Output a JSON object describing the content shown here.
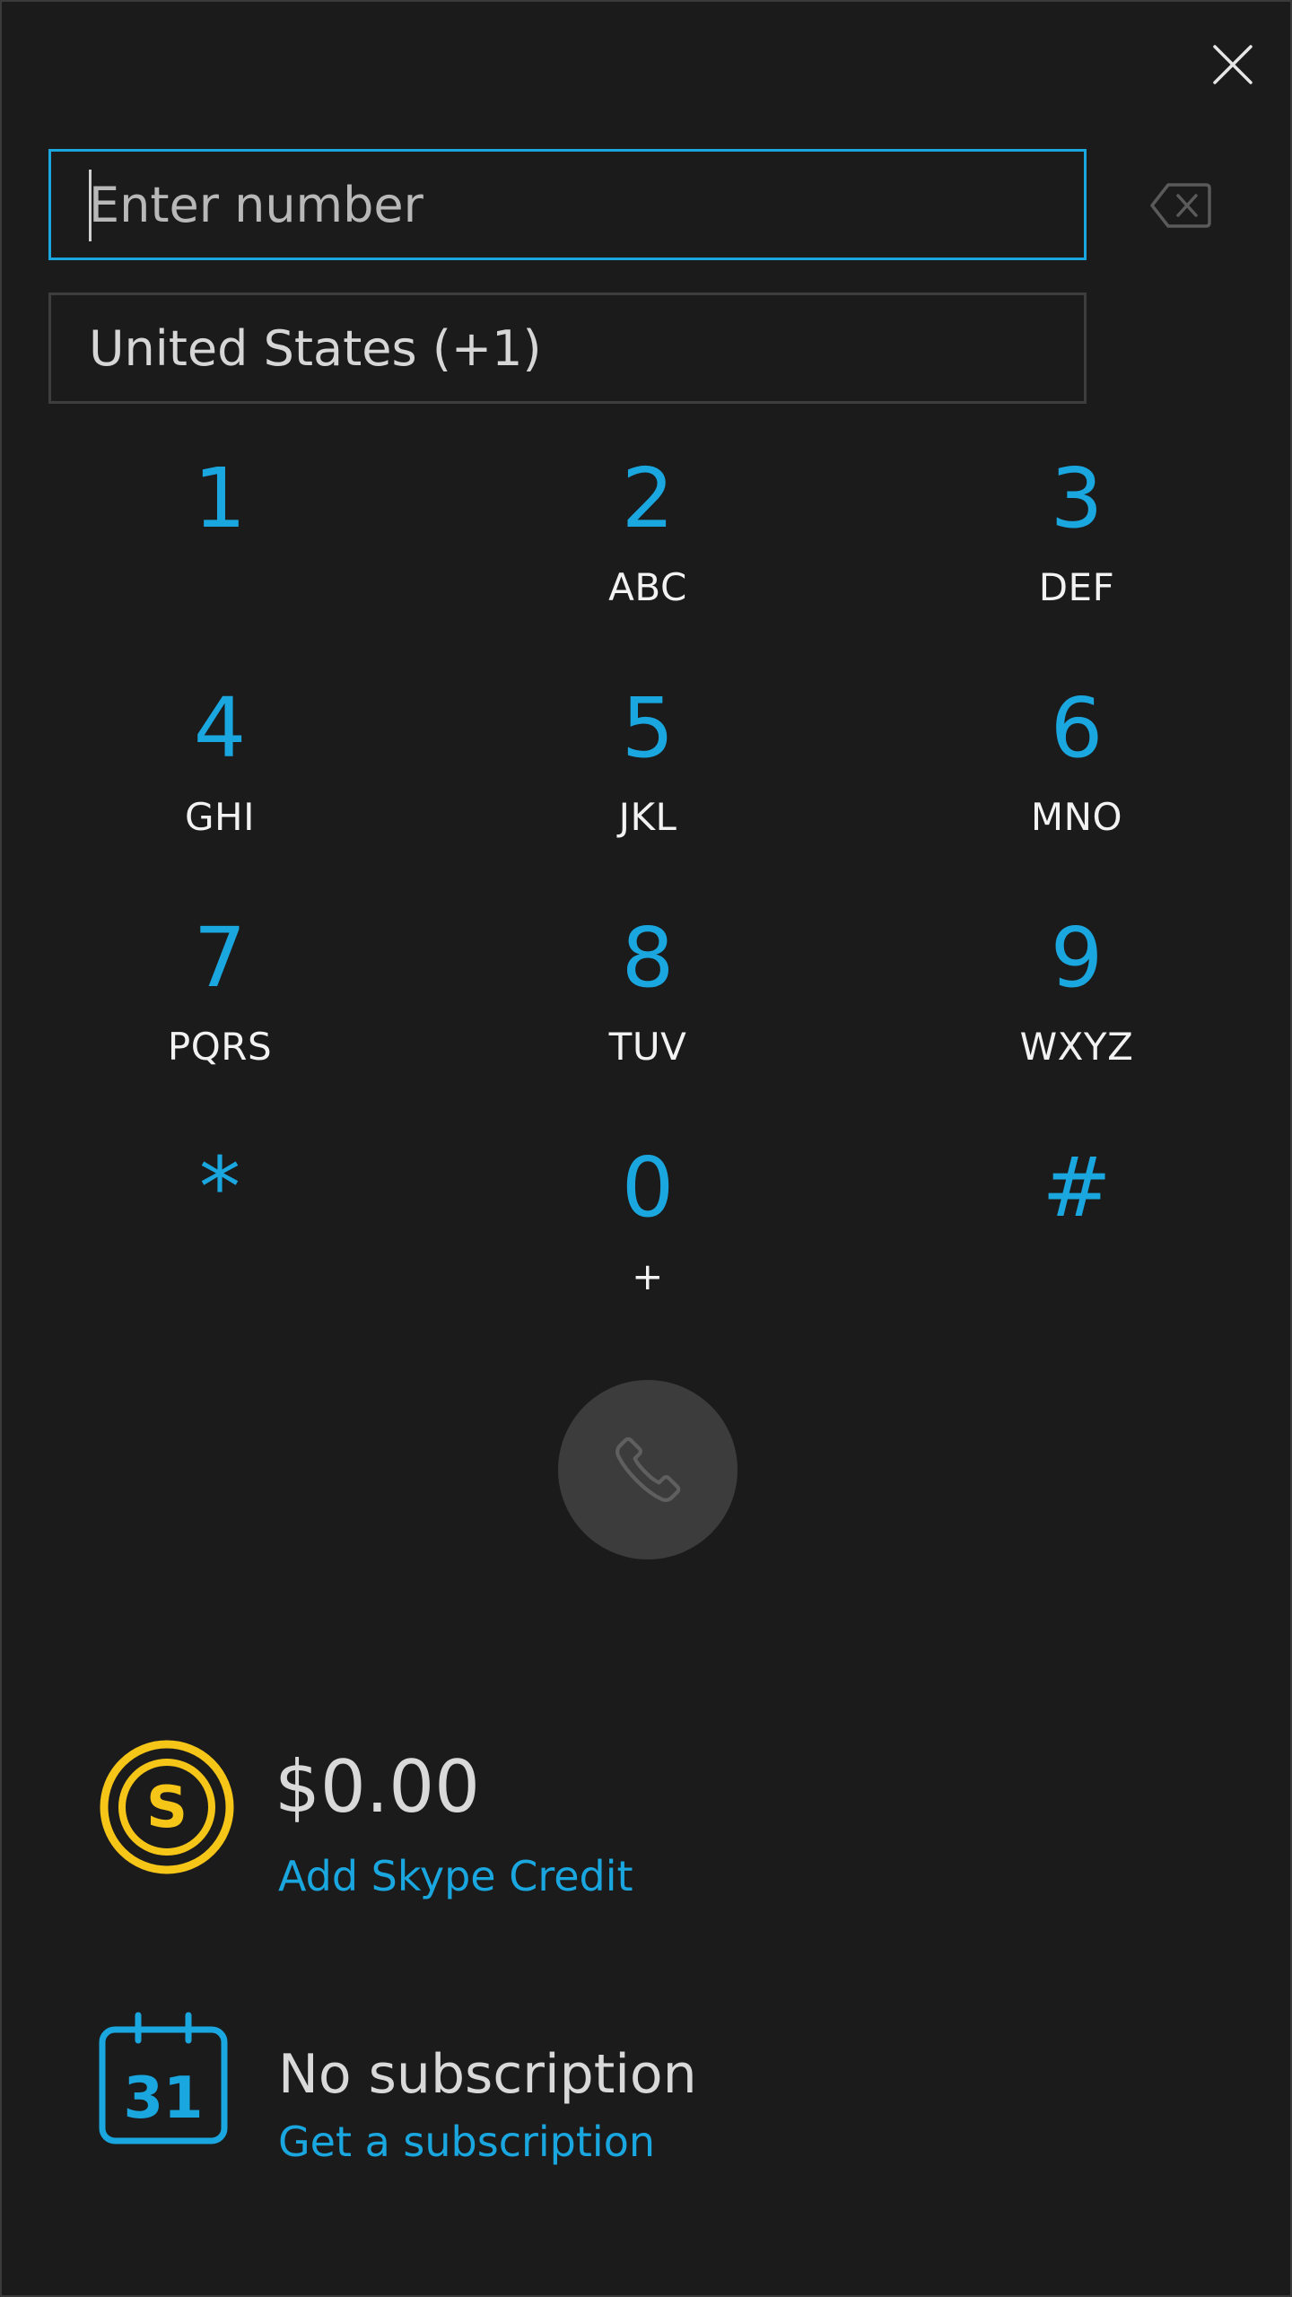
{
  "dialer": {
    "number_placeholder": "Enter number",
    "number_value": "",
    "country": "United States (+1)"
  },
  "keypad": [
    {
      "digit": "1",
      "letters": ""
    },
    {
      "digit": "2",
      "letters": "ABC"
    },
    {
      "digit": "3",
      "letters": "DEF"
    },
    {
      "digit": "4",
      "letters": "GHI"
    },
    {
      "digit": "5",
      "letters": "JKL"
    },
    {
      "digit": "6",
      "letters": "MNO"
    },
    {
      "digit": "7",
      "letters": "PQRS"
    },
    {
      "digit": "8",
      "letters": "TUV"
    },
    {
      "digit": "9",
      "letters": "WXYZ"
    },
    {
      "digit": "*",
      "letters": ""
    },
    {
      "digit": "0",
      "letters": "+"
    },
    {
      "digit": "#",
      "letters": ""
    }
  ],
  "credit": {
    "amount": "$0.00",
    "add_label": "Add Skype Credit",
    "icon_letter": "S"
  },
  "subscription": {
    "status": "No subscription",
    "get_label": "Get a subscription",
    "calendar_day": "31"
  },
  "icons": {
    "close": "close-icon",
    "backspace": "backspace-icon",
    "call": "phone-icon",
    "credit": "skype-credit-icon",
    "subscription": "calendar-icon"
  },
  "colors": {
    "background": "#1b1b1b",
    "accent": "#1aa7e0",
    "credit_gold": "#f5c518",
    "call_button": "#3c3c3c"
  }
}
